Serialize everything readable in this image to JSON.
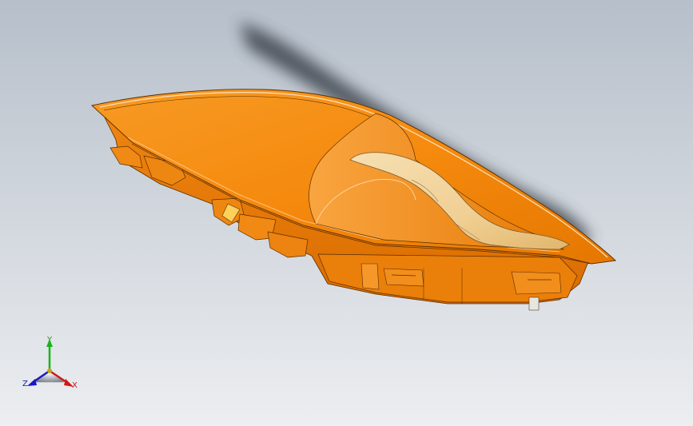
{
  "viewport": {
    "background_top": "#b9c2cc",
    "background_bottom": "#e8eaed",
    "model_colors": {
      "body_main": "#f5890f",
      "body_light": "#ffa33a",
      "body_dark": "#d06a00",
      "edge": "#5a2d00",
      "handle": "#f3d7a3",
      "handle_shade": "#e0bb78"
    }
  },
  "triad": {
    "x_label": "X",
    "y_label": "Y",
    "z_label": "Z",
    "x_color": "#d01818",
    "y_color": "#18b418",
    "z_color": "#1818c8"
  }
}
